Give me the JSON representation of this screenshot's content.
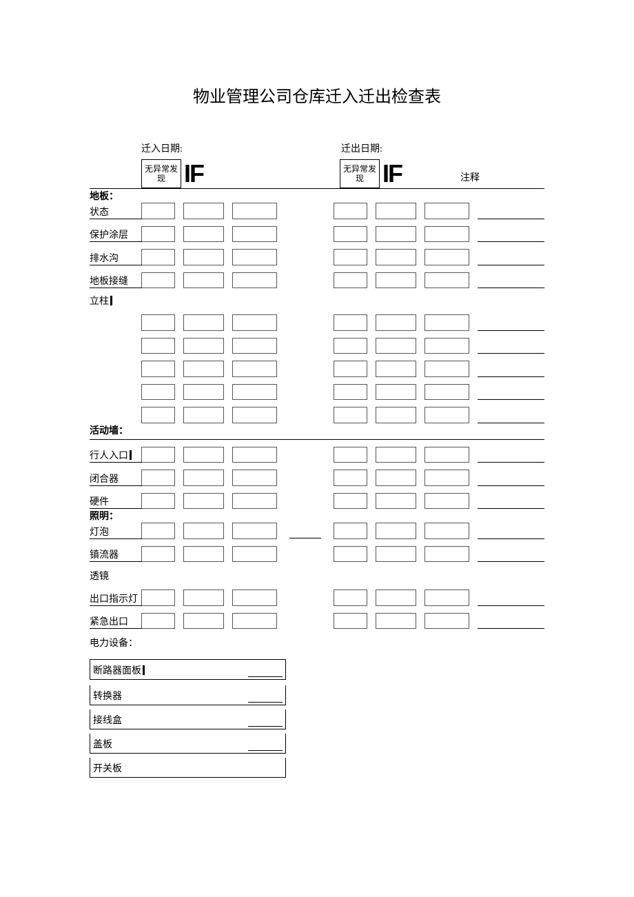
{
  "title": "物业管理公司仓库迁入迁出检查表",
  "header": {
    "move_in_date_label": "迁入日期:",
    "move_out_date_label": "迁出日期:",
    "no_abnormal": "无异常发现",
    "if_text": "IF",
    "notes_label": "注释"
  },
  "sections": {
    "floor": {
      "title": "地板：",
      "items": [
        "状态",
        "保护涂层",
        "排水沟",
        "地板接缝"
      ]
    },
    "pillar": {
      "title": "立柱"
    },
    "movable_wall": {
      "title": "活动墙：",
      "items": [
        "行人入口",
        "闭合器",
        "硬件"
      ]
    },
    "lighting": {
      "title": "照明：",
      "items": [
        "灯泡",
        "镇流器",
        "透镜",
        "出口指示灯",
        "紧急出口"
      ]
    },
    "electrical": {
      "title": "电力设备：",
      "items": [
        "断路器面板",
        "转换器",
        "接线盒",
        "盖板",
        "开关板"
      ]
    }
  }
}
